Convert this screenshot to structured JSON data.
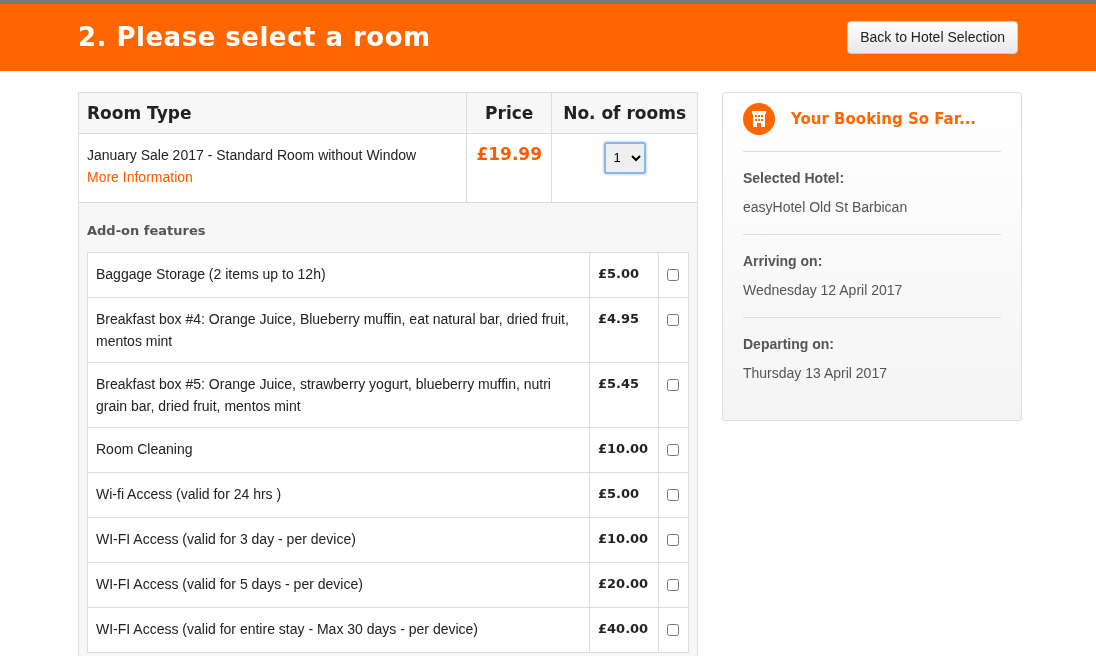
{
  "header": {
    "title": "2. Please select a room",
    "back_button": "Back to Hotel Selection"
  },
  "rooms_table": {
    "columns": [
      "Room Type",
      "Price",
      "No. of rooms"
    ],
    "rows": [
      {
        "name": "January Sale 2017 - Standard Room without Window",
        "link": "More Information",
        "price": "£19.99",
        "quantity": "1"
      }
    ]
  },
  "addons": {
    "heading": "Add-on features",
    "items": [
      {
        "name": "Baggage Storage (2 items up to 12h)",
        "price": "£5.00",
        "checked": false
      },
      {
        "name": "Breakfast box #4: Orange Juice, Blueberry muffin, eat natural bar, dried fruit, mentos mint",
        "price": "£4.95",
        "checked": false
      },
      {
        "name": "Breakfast box #5: Orange Juice, strawberry yogurt, blueberry muffin, nutri grain bar, dried fruit, mentos mint",
        "price": "£5.45",
        "checked": false
      },
      {
        "name": "Room Cleaning",
        "price": "£10.00",
        "checked": false
      },
      {
        "name": "Wi-fi Access (valid for 24 hrs )",
        "price": "£5.00",
        "checked": false
      },
      {
        "name": "WI-FI Access (valid for 3 day - per device)",
        "price": "£10.00",
        "checked": false
      },
      {
        "name": "WI-FI Access (valid for 5 days - per device)",
        "price": "£20.00",
        "checked": false
      },
      {
        "name": "WI-FI Access (valid for entire stay - Max 30 days - per device)",
        "price": "£40.00",
        "checked": false
      }
    ]
  },
  "booking": {
    "title": "Your Booking So Far...",
    "sections": [
      {
        "label": "Selected Hotel:",
        "value": "easyHotel Old St Barbican"
      },
      {
        "label": "Arriving on:",
        "value": "Wednesday 12 April 2017"
      },
      {
        "label": "Departing on:",
        "value": "Thursday 13 April 2017"
      }
    ]
  }
}
